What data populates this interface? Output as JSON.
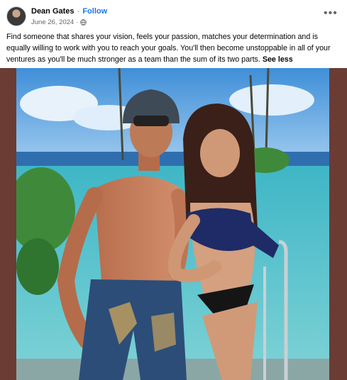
{
  "post": {
    "author": "Dean Gates",
    "separator": "·",
    "follow_label": "Follow",
    "date": "June 26, 2024",
    "meta_separator": "·",
    "privacy_icon": "globe-icon",
    "more_icon": "•••",
    "caption": "Find someone that shares your vision, feels your passion, matches your determination and is equally willing to work with you to reach your goals. You'll then become unstoppable in all of your ventures as you'll be much stronger as a team than the sum of its two parts.",
    "see_less_label": "See less"
  },
  "colors": {
    "link": "#1877f2",
    "secondary_text": "#65676b",
    "media_frame": "#6b3c33"
  }
}
